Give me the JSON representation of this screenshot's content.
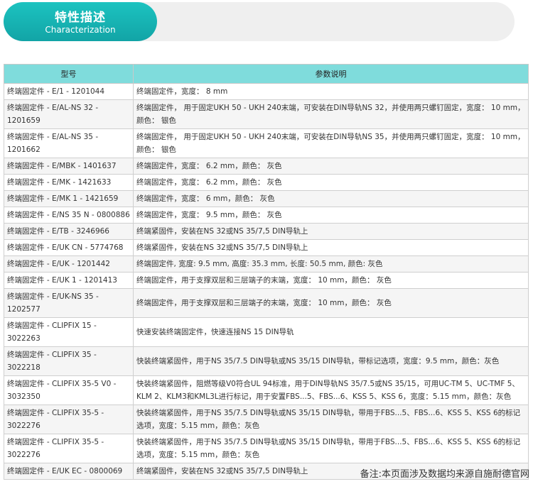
{
  "header": {
    "title": "特性描述",
    "subtitle": "Characterization"
  },
  "table": {
    "columns": [
      "型号",
      "参数说明"
    ],
    "rows": [
      {
        "model": "终端固定件 - E/1 - 1201044",
        "desc": "终端固定件，宽度： 8 mm"
      },
      {
        "model": "终端固定件 - E/AL-NS 32 - 1201659",
        "desc": "终端固定件， 用于固定UKH 50 - UKH 240末端，可安装在DIN导轨NS 32，并使用两只螺钉固定，宽度： 10 mm，颜色： 银色"
      },
      {
        "model": "终端固定件 - E/AL-NS 35 - 1201662",
        "desc": "终端固定件， 用于固定UKH 50 - UKH 240末端，可安装在DIN导轨NS 35，并使用两只螺钉固定，宽度： 10 mm，颜色： 银色"
      },
      {
        "model": "终端固定件 - E/MBK - 1401637",
        "desc": "终端固定件，宽度： 6.2 mm，颜色： 灰色"
      },
      {
        "model": "终端固定件 - E/MK - 1421633",
        "desc": "终端固定件，宽度： 6.2 mm，颜色： 灰色"
      },
      {
        "model": "终端固定件 - E/MK 1 - 1421659",
        "desc": "终端固定件，宽度： 6 mm，颜色： 灰色"
      },
      {
        "model": "终端固定件 - E/NS 35 N - 0800886",
        "desc": "终端固定件，宽度： 9.5 mm，颜色： 灰色"
      },
      {
        "model": "终端固定件 - E/TB - 3246966",
        "desc": "终端紧固件，安装在NS 32或NS 35/7,5 DIN导轨上"
      },
      {
        "model": "终端固定件 - E/UK CN - 5774768",
        "desc": "终端紧固件，安装在NS 32或NS 35/7,5 DIN导轨上"
      },
      {
        "model": "终端固定件 - E/UK - 1201442",
        "desc": "终端固定件, 宽度: 9.5 mm, 高度: 35.3 mm, 长度: 50.5 mm, 颜色: 灰色"
      },
      {
        "model": "终端固定件 - E/UK 1 - 1201413",
        "desc": "终端固定件，用于支撑双层和三层端子的末端，宽度： 10 mm，颜色： 灰色"
      },
      {
        "model": "终端固定件 - E/UK-NS 35 - 1202577",
        "desc": "终端固定件，用于支撑双层和三层端子的末端，宽度： 10 mm，颜色： 灰色"
      },
      {
        "model": "终端固定件 - CLIPFIX 15 - 3022263",
        "desc": "快速安装终端固定件，快速连接NS 15 DIN导轨"
      },
      {
        "model": "终端固定件 - CLIPFIX 35 - 3022218",
        "desc": "快装终端紧固件，用于NS 35/7.5 DIN导轨或NS 35/15 DIN导轨，带标记选项，宽度：9.5 mm，颜色：灰色"
      },
      {
        "model": "终端固定件 - CLIPFIX 35-5 V0 - 3032350",
        "desc": "快装终端紧固件，阻燃等级V0符合UL 94标准，用于DIN导轨NS 35/7.5或NS 35/15，可用UC-TM 5、UC-TMF 5、KLM 2、KLM3和KML3L进行标记，用于安置FBS...5、FBS...6、KSS 5、KSS 6，宽度：5.15 mm，颜色：灰色"
      },
      {
        "model": "终端固定件 - CLIPFIX 35-5 - 3022276",
        "desc": "快装终端紧固件，用于NS 35/7.5 DIN导轨或NS 35/15 DIN导轨，带用于FBS...5、FBS...6、KSS 5、KSS 6的标记选项，宽度：5.15 mm，颜色：灰色"
      },
      {
        "model": "终端固定件 - CLIPFIX 35-5 - 3022276",
        "desc": "快装终端紧固件，用于NS 35/7.5 DIN导轨或NS 35/15 DIN导轨，带用于FBS...5、FBS...6、KSS 5、KSS 6的标记选项，宽度：5.15 mm，颜色：灰色"
      },
      {
        "model": "终端固定件 - E/UK EC - 0800069",
        "desc": "终端紧固件，安装在NS 32或NS 35/7,5 DIN导轨上"
      }
    ]
  },
  "footer": {
    "note": "备注:本页面涉及数据均来源自施耐德官网"
  },
  "colors": {
    "accent": "#14b1b1",
    "header_row": "#7fdcdc",
    "banner_bg": "#efefef"
  }
}
